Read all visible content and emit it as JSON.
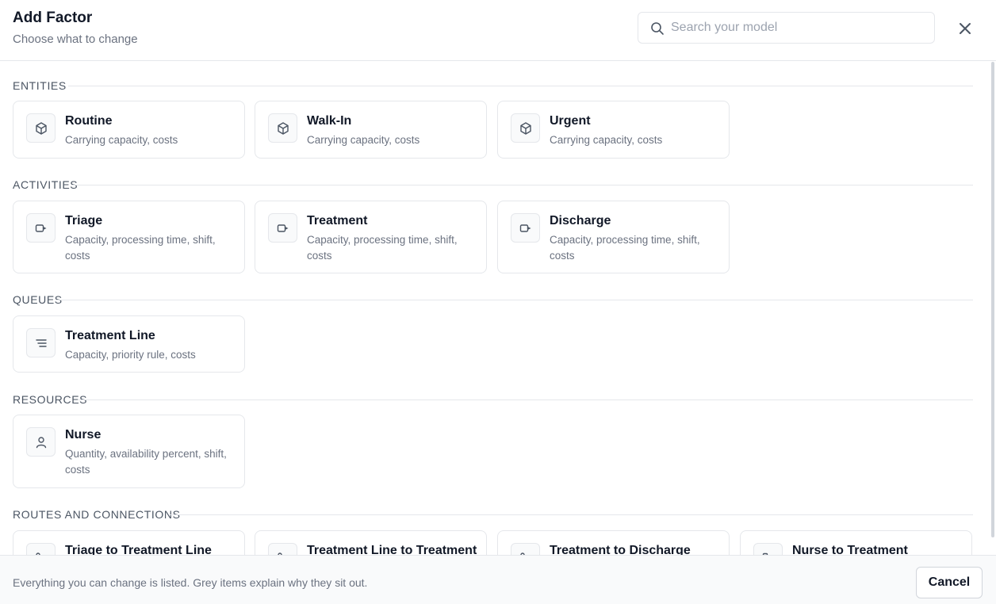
{
  "header": {
    "title": "Add Factor",
    "subtitle": "Choose what to change",
    "search_placeholder": "Search your model",
    "search_value": ""
  },
  "sections": [
    {
      "label": "ENTITIES",
      "items": [
        {
          "title": "Routine",
          "desc": "Carrying capacity, costs",
          "icon": "cube-icon"
        },
        {
          "title": "Walk-In",
          "desc": "Carrying capacity, costs",
          "icon": "cube-icon"
        },
        {
          "title": "Urgent",
          "desc": "Carrying capacity, costs",
          "icon": "cube-icon"
        }
      ]
    },
    {
      "label": "ACTIVITIES",
      "items": [
        {
          "title": "Triage",
          "desc": "Capacity, processing time, shift, costs",
          "icon": "activity-icon"
        },
        {
          "title": "Treatment",
          "desc": "Capacity, processing time, shift, costs",
          "icon": "activity-icon"
        },
        {
          "title": "Discharge",
          "desc": "Capacity, processing time, shift, costs",
          "icon": "activity-icon"
        }
      ]
    },
    {
      "label": "QUEUES",
      "items": [
        {
          "title": "Treatment Line",
          "desc": "Capacity, priority rule, costs",
          "icon": "queue-lines-icon"
        }
      ]
    },
    {
      "label": "RESOURCES",
      "items": [
        {
          "title": "Nurse",
          "desc": "Quantity, availability percent, shift, costs",
          "icon": "person-icon"
        }
      ]
    },
    {
      "label": "ROUTES AND CONNECTIONS",
      "items": [
        {
          "title": "Triage to Treatment Line",
          "desc": "",
          "icon": "route-icon"
        },
        {
          "title": "Treatment Line to Treatment",
          "desc": "",
          "icon": "route-icon"
        },
        {
          "title": "Treatment to Discharge",
          "desc": "",
          "icon": "route-icon"
        },
        {
          "title": "Nurse to Treatment",
          "desc": "",
          "icon": "connection-icon"
        }
      ]
    }
  ],
  "footer": {
    "note": "Everything you can change is listed. Grey items explain why they sit out.",
    "cancel_label": "Cancel"
  }
}
